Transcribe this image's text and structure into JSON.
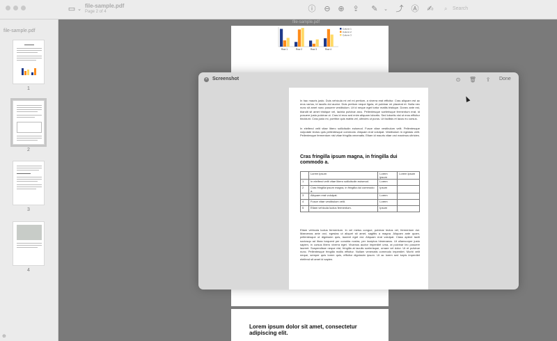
{
  "toolbar": {
    "file_name": "file-sample.pdf",
    "page_info": "Page 2 of 4",
    "search_placeholder": "Search"
  },
  "sidebar": {
    "title": "file-sample.pdf",
    "pages": [
      {
        "number": "1"
      },
      {
        "number": "2"
      },
      {
        "number": "3"
      },
      {
        "number": "4"
      }
    ]
  },
  "document": {
    "page_label": "file-sample.pdf",
    "bottom_heading": "Lorem ipsum dolor sit amet, consectetur adipiscing elit."
  },
  "chart_data": {
    "type": "bar",
    "categories": [
      "Row 1",
      "Row 2",
      "Row 3",
      "Row 4"
    ],
    "series": [
      {
        "name": "Column 1",
        "values": [
          9.1,
          2.4,
          3.1,
          4.3
        ]
      },
      {
        "name": "Column 2",
        "values": [
          3.2,
          8.8,
          1.5,
          9.0
        ]
      },
      {
        "name": "Column 3",
        "values": [
          4.5,
          9.6,
          3.7,
          6.2
        ]
      }
    ],
    "colors": [
      "#1f3a8a",
      "#ff8c1a",
      "#ffd966"
    ],
    "ylim": [
      0,
      10
    ]
  },
  "overlay": {
    "title": "Screenshot",
    "done_label": "Done",
    "para1": "In hac mauris justo. Duis vehicula mi vel mi pretium, a viverra erat efficitur. Cras aliquam est ac eros varius, id iaculis dui auctor. Duis pretium neque ligula, et pulvinar mi placerat et. Nulla nec nunc sit amet nunc posuere vestibulum. Ut id neque eget tortor mattis tristique. Donec ante est, blandit sit amet tristique vel, lacinia pulvinar arcu. Pellentesque scelerisque fermentum erat, id posuere justo pulvinar ut. Cras id eros sed enim aliquam lobortis. Sed lobortis nisl ut eros efficitur tincidunt. Cras justo mi, porttitor quis mattis vel, ultricies ut purus. Ut facilisis et lacus eu cursus.",
    "para2": "In eleifend velit vitae libero sollicitudin euismod. Fusce vitae vestibulum velit. Pellentesque vulputate lectus quis pellentesque commodo. Aliquam erat volutpat. Vestibulum in egestas velit. Pellentesque fermentum nisl vitae fringilla venenatis. Etiam id mauris vitae orci maximus ultricies.",
    "heading": "Cras fringilla ipsum magna, in fringilla dui commodo a.",
    "table": [
      [
        "",
        "Lorem ipsum",
        "Lorem ipsum",
        "Lorem ipsum"
      ],
      [
        "1",
        "In eleifend velit vitae libero sollicitudin euismod.",
        "Lorem",
        ""
      ],
      [
        "2",
        "Cras fringilla ipsum magna, in fringilla dui commodo a.",
        "Ipsum",
        ""
      ],
      [
        "3",
        "Aliquam erat volutpat.",
        "Lorem",
        ""
      ],
      [
        "4",
        "Fusce vitae vestibulum velit.",
        "Lorem",
        ""
      ],
      [
        "5",
        "Etiam vehicula luctus fermentum.",
        "Ipsum",
        ""
      ]
    ],
    "para3": "Etiam vehicula luctus fermentum. In vel metus congue, pulvinar lectus vel, fermentum dui. Maecenas ante orci, egestas ut aliquet sit amet, sagittis a magna. Aliquam ante quam, pellentesque ut dignissim quis, laoreet eget est. Aliquam erat volutpat. Class aptent taciti sociosqu ad litora torquent per conubia nostra, per inceptos himenaeos. Ut ullamcorper justo sapien, in cursus libero viverra eget. Vivamus auctor imperdiet urna, at pulvinar leo posuere laoreet. Suspendisse neque nisl, fringilla at iaculis scelerisque, ornare vel dolor. Ut et pulvinar nunc. Pellentesque fringilla mollis efficitur. Nullam venenatis commodo imperdiet. Morbi velit neque, semper quis lorem quis, efficitur dignissim ipsum. Ut ac lorem sed turpis imperdiet eleifend sit amet id sapien."
  }
}
